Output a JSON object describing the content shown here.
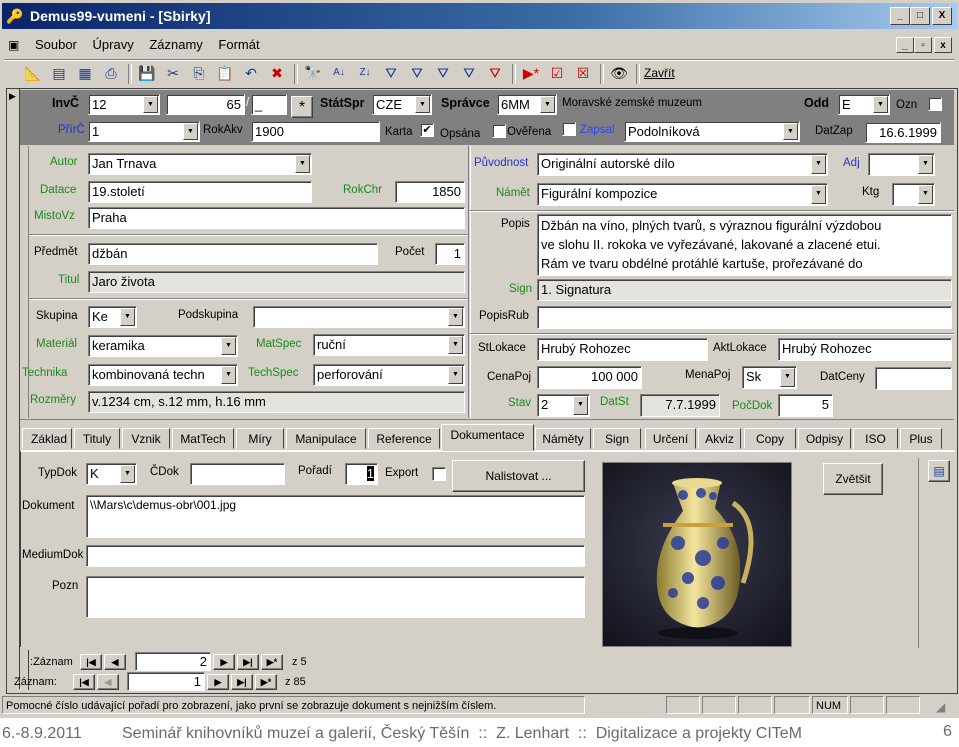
{
  "window": {
    "title": "Demus99-vumeni - [Sbirky]",
    "minimize": "_",
    "restore": "□",
    "close": "X"
  },
  "menu": {
    "items": [
      "Soubor",
      "Úpravy",
      "Záznamy",
      "Formát"
    ]
  },
  "toolbar": {
    "icons": [
      "design-view",
      "form-view",
      "datasheet-view",
      "print",
      "save-record",
      "cut",
      "copy",
      "paste",
      "undo",
      "delete",
      "find",
      "sort-ascending",
      "sort-descending",
      "filter-by-selection",
      "filter-by-form",
      "apply-filter",
      "advanced-filter",
      "remove-filter",
      "new-record",
      "edit-record",
      "delete-record",
      "view"
    ],
    "close_label": "Zavřít"
  },
  "header": {
    "invc_label": "InvČ",
    "invc": "12",
    "invc2": "65",
    "slash": "/",
    "invc3": "_",
    "star": "*",
    "statspr_label": "StátSpr",
    "statspr": "CZE",
    "spravce_label": "Správce",
    "spravce": "6MM",
    "museum": "Moravské zemské muzeum",
    "odd_label": "Odd",
    "odd": "E",
    "ozn_label": "Ozn",
    "prirc_label": "PřírČ",
    "prirc": "1",
    "rokakv_label": "RokAkv",
    "rokakv": "1900",
    "karta_label": "Karta",
    "karta_checked": true,
    "opsana_label": "Opsána",
    "overena_label": "Ověřena",
    "zapsal_label": "Zapsal",
    "zapsal": "Podolníková",
    "datzap_label": "DatZap",
    "datzap": "16.6.1999"
  },
  "left": {
    "autor_label": "Autor",
    "autor": "Jan Trnava",
    "datace_label": "Datace",
    "datace": "19.století",
    "rokchr_label": "RokChr",
    "rokchr": "1850",
    "mistovz_label": "MistoVz",
    "mistovz": "Praha",
    "predmet_label": "Předmět",
    "predmet": "džbán",
    "pocet_label": "Počet",
    "pocet": "1",
    "titul_label": "Titul",
    "titul": "Jaro života",
    "skupina_label": "Skupina",
    "skupina": "Ke",
    "podskupina_label": "Podskupina",
    "podskupina": "",
    "material_label": "Materiál",
    "material": "keramika",
    "matspec_label": "MatSpec",
    "matspec": "ruční",
    "technika_label": "Technika",
    "technika": "kombinovaná techn",
    "techspec_label": "TechSpec",
    "techspec": "perforování",
    "rozmery_label": "Rozměry",
    "rozmery": "v.1234 cm, s.12 mm, h.16 mm"
  },
  "right": {
    "puvodnost_label": "Původnost",
    "puvodnost": "Originální autorské dílo",
    "adj_label": "Adj",
    "adj": "",
    "namet_label": "Námět",
    "namet": "Figurální kompozice",
    "ktg_label": "Ktg",
    "ktg": "",
    "popis_label": "Popis",
    "popis_lines": [
      "Džbán na víno, plných tvarů, s výraznou figurální výzdobou",
      "ve slohu II. rokoka ve vyřezávané, lakované a zlacené etui.",
      "Rám ve tvaru obdélné protáhlé kartuše, prořezávané do"
    ],
    "sign_label": "Sign",
    "sign": "1. Signatura",
    "popisrub_label": "PopisRub",
    "popisrub": "",
    "stlokace_label": "StLokace",
    "stlokace": "Hrubý Rohozec",
    "aktlokace_label": "AktLokace",
    "aktlokace": "Hrubý Rohozec",
    "cenapoj_label": "CenaPoj",
    "cenapoj": "100 000",
    "menapoj_label": "MenaPoj",
    "menapoj": "Sk",
    "datceny_label": "DatCeny",
    "datceny": "",
    "stav_label": "Stav",
    "stav": "2",
    "datst_label": "DatSt",
    "datst": "7.7.1999",
    "pocdok_label": "PočDok",
    "pocdok": "5"
  },
  "tabs": [
    "Základ",
    "Tituly",
    "Vznik",
    "MatTech",
    "Míry",
    "Manipulace",
    "Reference",
    "Dokumentace",
    "Náměty",
    "Sign",
    "Určení",
    "Akviz",
    "Copy",
    "Odpisy",
    "ISO",
    "Plus"
  ],
  "active_tab": "Dokumentace",
  "doc": {
    "typdok_label": "TypDok",
    "typdok": "K",
    "cdok_label": "ČDok",
    "cdok": "",
    "poradi_label": "Pořadí",
    "poradi": "1",
    "export_label": "Export",
    "nalistovat": "Nalistovat ...",
    "zvetsit": "Zvětšit",
    "dokument_label": "Dokument",
    "dokument": "\\\\Mars\\c\\demus-obr\\001.jpg",
    "mediumdok_label": "MediumDok",
    "mediumdok": "",
    "pozn_label": "Pozn",
    "pozn": ""
  },
  "subnav": {
    "label": "Záznam:",
    "current": "2",
    "total": "z 5"
  },
  "nav": {
    "label": "Záznam:",
    "current": "1",
    "total": "z 85"
  },
  "status": {
    "text": "Pomocné číslo udávající pořadí pro zobrazení, jako první se zobrazuje dokument s nejnižším číslem.",
    "num": "NUM"
  },
  "footer": {
    "date": "6.-8.9.2011",
    "text": "Seminář knihovníků muzeí a galerií, Český Těšín  ::  Z. Lenhart  ::  Digitalizace a projekty CITeM",
    "page": "6"
  },
  "colors": {
    "titlebar": "#0a246a",
    "green_label": "#1a8a1a",
    "blue_label": "#2233cc",
    "header_bg": "#808080"
  }
}
